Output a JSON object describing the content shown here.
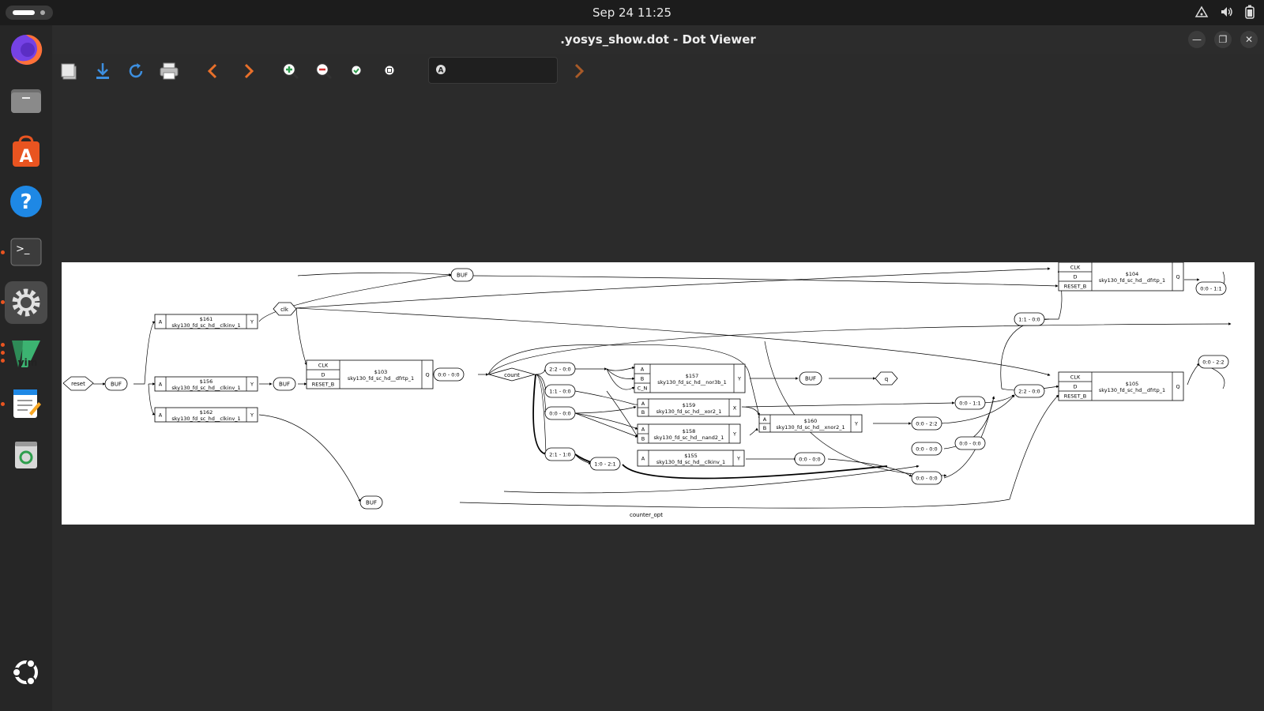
{
  "topbar": {
    "clock": "Sep 24  11:25",
    "icons": [
      "network-icon",
      "volume-icon",
      "battery-icon"
    ]
  },
  "dock": {
    "items": [
      {
        "name": "firefox",
        "icon": "firefox-icon"
      },
      {
        "name": "files",
        "icon": "folder-icon"
      },
      {
        "name": "app-center",
        "icon": "app-center-icon"
      },
      {
        "name": "help",
        "icon": "help-icon"
      },
      {
        "name": "terminal",
        "icon": "terminal-icon"
      },
      {
        "name": "settings",
        "icon": "gear-icon"
      },
      {
        "name": "vim",
        "icon": "vim-icon"
      },
      {
        "name": "text-editor",
        "icon": "text-editor-icon"
      },
      {
        "name": "trash",
        "icon": "trash-icon"
      },
      {
        "name": "show-apps",
        "icon": "ubuntu-icon"
      }
    ]
  },
  "window": {
    "title": ".yosys_show.dot - Dot Viewer",
    "search": {
      "value": "",
      "placeholder": ""
    },
    "toolbar": [
      "open-icon",
      "save-icon",
      "reload-icon",
      "print-icon",
      "back-icon",
      "forward-icon",
      "zoom-in-icon",
      "zoom-out-icon",
      "zoom-fit-icon",
      "zoom-100-icon",
      "find-next-icon"
    ]
  },
  "graph": {
    "caption": "counter_opt",
    "ports": {
      "reset": "reset",
      "clk": "clk",
      "count": "count",
      "q": "q"
    },
    "buf": "BUF",
    "cells": {
      "c161": {
        "id": "$161",
        "type": "sky130_fd_sc_hd__clkinv_1",
        "in": [
          "A"
        ],
        "out": "Y"
      },
      "c156": {
        "id": "$156",
        "type": "sky130_fd_sc_hd__clkinv_1",
        "in": [
          "A"
        ],
        "out": "Y"
      },
      "c162": {
        "id": "$162",
        "type": "sky130_fd_sc_hd__clkinv_1",
        "in": [
          "A"
        ],
        "out": "Y"
      },
      "c103": {
        "id": "$103",
        "type": "sky130_fd_sc_hd__dfrtp_1",
        "in": [
          "CLK",
          "D",
          "RESET_B"
        ],
        "out": "Q"
      },
      "c157": {
        "id": "$157",
        "type": "sky130_fd_sc_hd__nor3b_1",
        "in": [
          "A",
          "B",
          "C_N"
        ],
        "out": "Y"
      },
      "c159": {
        "id": "$159",
        "type": "sky130_fd_sc_hd__xor2_1",
        "in": [
          "A",
          "B"
        ],
        "out": "X"
      },
      "c158": {
        "id": "$158",
        "type": "sky130_fd_sc_hd__nand2_1",
        "in": [
          "A",
          "B"
        ],
        "out": "Y"
      },
      "c155": {
        "id": "$155",
        "type": "sky130_fd_sc_hd__clkinv_1",
        "in": [
          "A"
        ],
        "out": "Y"
      },
      "c160": {
        "id": "$160",
        "type": "sky130_fd_sc_hd__xnor2_1",
        "in": [
          "A",
          "B"
        ],
        "out": "Y"
      },
      "c104": {
        "id": "$104",
        "type": "sky130_fd_sc_hd__dfrtp_1",
        "in": [
          "CLK",
          "D",
          "RESET_B"
        ],
        "out": "Q"
      },
      "c105": {
        "id": "$105",
        "type": "sky130_fd_sc_hd__dfrtp_1",
        "in": [
          "CLK",
          "D",
          "RESET_B"
        ],
        "out": "Q"
      }
    },
    "slices": {
      "s1": "0:0 - 0:0",
      "s2": "2:2 - 0:0",
      "s3": "1:1 - 0:0",
      "s4": "0:0 - 0:0",
      "s5": "2:1 - 1:0",
      "s6": "1:0 - 2:1",
      "s7": "0:0 - 0:0",
      "s8": "0:0 - 1:1",
      "s9": "0:0 - 2:2",
      "s10": "0:0 - 0:0",
      "s11": "0:0 - 0:0",
      "s12": "0:0 - 0:0",
      "s13": "1:1 - 0:0",
      "s14": "2:2 - 0:0",
      "s15": "0:0 - 1:1",
      "s16": "0:0 - 2:2"
    }
  }
}
